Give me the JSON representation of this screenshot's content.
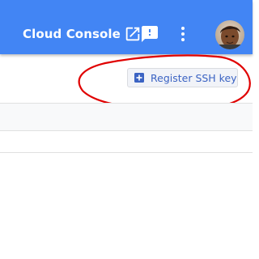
{
  "header": {
    "cloud_console_label": "Cloud Console",
    "open_icon": "open-in-new-icon",
    "feedback_icon": "feedback-icon",
    "more_icon": "more-vert-icon",
    "avatar": "user-avatar",
    "background_color": "#4285f4",
    "text_color": "#ffffff"
  },
  "actions": {
    "register_ssh_key_label": "Register SSH key",
    "register_icon": "add-box-icon",
    "accent_color": "#3b63c3"
  },
  "annotation": {
    "type": "red-hand-drawn-circle",
    "color": "#e00000"
  }
}
